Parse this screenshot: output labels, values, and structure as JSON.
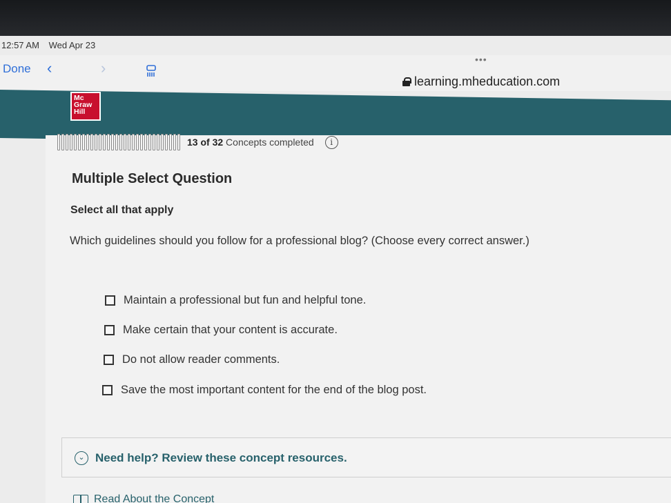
{
  "status_bar": {
    "time": "12:57 AM",
    "date": "Wed Apr 23"
  },
  "browser": {
    "done_label": "Done",
    "back_icon": "chevron-left-icon",
    "forward_icon": "chevron-right-icon",
    "tabs_icon": "tabs-icon",
    "menu_dots": "•••",
    "url": "learning.mheducation.com",
    "lock_icon": "lock-icon"
  },
  "header": {
    "logo_text": [
      "Mc",
      "Graw",
      "Hill"
    ],
    "brand_color": "#27616b",
    "logo_color": "#c8102e"
  },
  "progress": {
    "completed": "13",
    "of_label": "of",
    "total": "32",
    "suffix": "Concepts completed",
    "info_icon": "i",
    "fraction": 0.406
  },
  "question": {
    "type": "Multiple Select Question",
    "instruction": "Select all that apply",
    "prompt": "Which guidelines should you follow for a professional blog? (Choose every correct answer.)",
    "choices": [
      "Maintain a professional but fun and helpful tone.",
      "Make certain that your content is accurate.",
      "Do not allow reader comments.",
      "Save the most important content for the end of the blog post."
    ]
  },
  "help": {
    "label": "Need help? Review these concept resources.",
    "link_label": "Read About the Concept"
  }
}
